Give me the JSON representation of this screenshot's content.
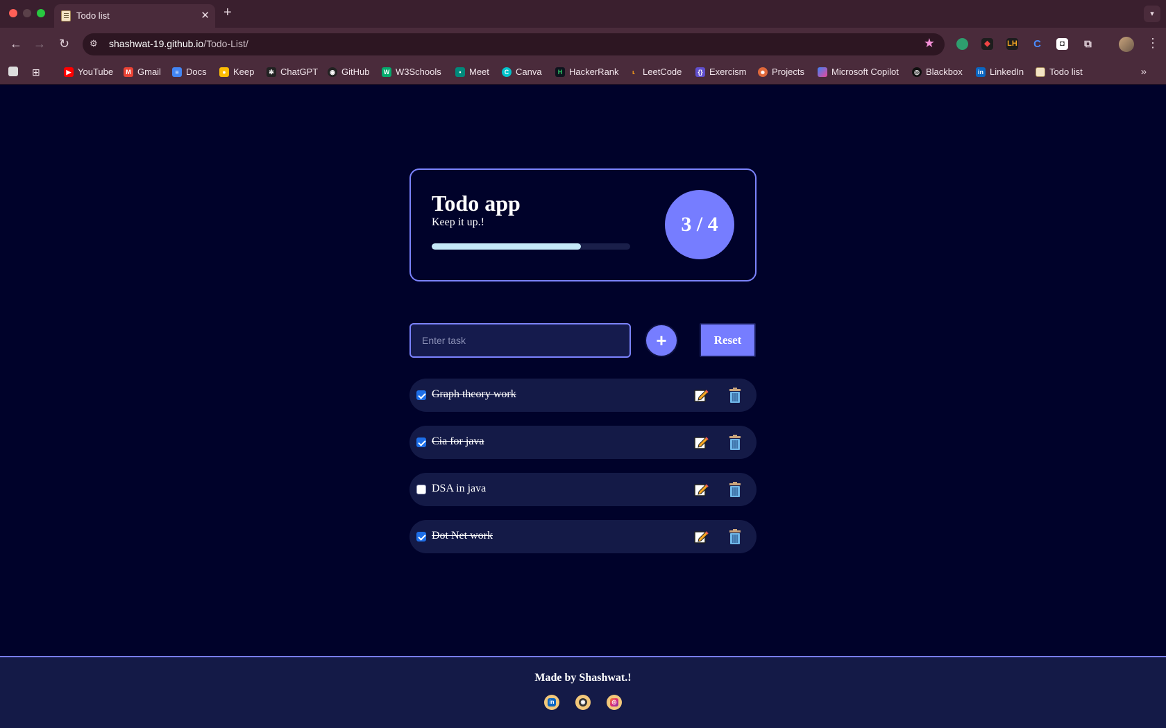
{
  "browser": {
    "tab_title": "Todo list",
    "url_host": "shashwat-19.github.io",
    "url_path": "/Todo-List/",
    "bookmarks": [
      {
        "label": "YouTube",
        "icon": "youtube-icon",
        "color": "#ff0000"
      },
      {
        "label": "Gmail",
        "icon": "gmail-icon",
        "color": "#ea4335"
      },
      {
        "label": "Docs",
        "icon": "docs-icon",
        "color": "#4285f4"
      },
      {
        "label": "Keep",
        "icon": "keep-icon",
        "color": "#fbbc04"
      },
      {
        "label": "ChatGPT",
        "icon": "chatgpt-icon",
        "color": "#222222"
      },
      {
        "label": "GitHub",
        "icon": "github-icon",
        "color": "#222222"
      },
      {
        "label": "W3Schools",
        "icon": "w3schools-icon",
        "color": "#04aa6d"
      },
      {
        "label": "Meet",
        "icon": "meet-icon",
        "color": "#00897b"
      },
      {
        "label": "Canva",
        "icon": "canva-icon",
        "color": "#00c4cc"
      },
      {
        "label": "HackerRank",
        "icon": "hackerrank-icon",
        "color": "#0e141e"
      },
      {
        "label": "LeetCode",
        "icon": "leetcode-icon",
        "color": "#ffa116"
      },
      {
        "label": "Exercism",
        "icon": "exercism-icon",
        "color": "#604fcd"
      },
      {
        "label": "Projects",
        "icon": "projects-icon",
        "color": "#e0683a"
      },
      {
        "label": "Microsoft Copilot",
        "icon": "copilot-icon",
        "color": "#6a5cff"
      },
      {
        "label": "Blackbox",
        "icon": "blackbox-icon",
        "color": "#111111"
      },
      {
        "label": "LinkedIn",
        "icon": "linkedin-icon",
        "color": "#0a66c2"
      },
      {
        "label": "Todo list",
        "icon": "todo-favicon-icon",
        "color": "#f3e3c3"
      }
    ]
  },
  "app": {
    "title": "Todo app",
    "subtitle": "Keep it up.!",
    "completed": 3,
    "total": 4,
    "count_label": "3 / 4",
    "progress_fraction": 0.75,
    "input_placeholder": "Enter task",
    "input_value": "",
    "add_label": "+",
    "reset_label": "Reset",
    "tasks": [
      {
        "text": "Graph theory work",
        "done": true
      },
      {
        "text": "Cia for java",
        "done": true
      },
      {
        "text": "DSA in java",
        "done": false
      },
      {
        "text": "Dot Net work",
        "done": true
      }
    ]
  },
  "footer": {
    "text": "Made by Shashwat.!",
    "socials": [
      "linkedin-icon",
      "github-icon",
      "instagram-icon"
    ]
  },
  "colors": {
    "background": "#00022a",
    "accent": "#767dff",
    "task_bg": "#141a47",
    "progress_fill": "#c5e8f7"
  }
}
